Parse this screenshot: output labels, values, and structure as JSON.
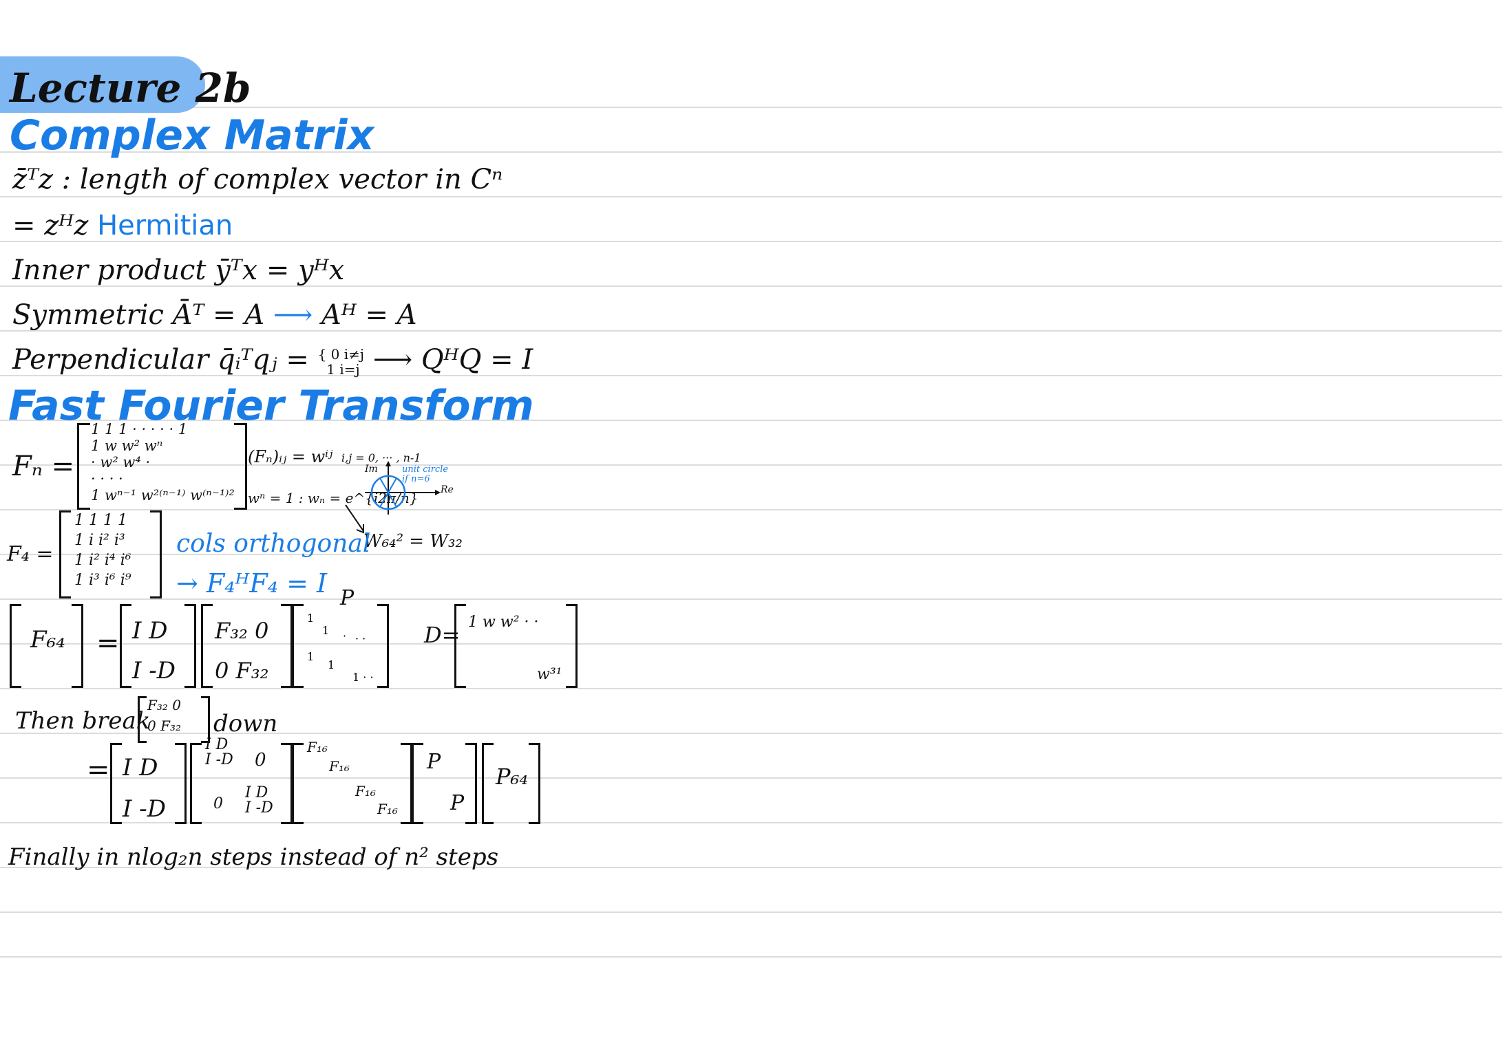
{
  "title": "Lecture 2b",
  "sections": {
    "complex_matrix": {
      "heading": "Complex Matrix",
      "line1": "z̄ᵀz : length of complex vector in Cⁿ",
      "line2_prefix": "= zᴴz",
      "line2_label": "Hermitian",
      "line3": "Inner product ȳᵀx = yᴴx",
      "line4_left": "Symmetric Āᵀ = A",
      "line4_right": "Aᴴ = A",
      "line5_left": "Perpendicular q̄ᵢᵀqⱼ =",
      "line5_case1": "0  i≠j",
      "line5_case2": "1  i=j",
      "line5_right": "QᴴQ = I"
    },
    "fft": {
      "heading": "Fast Fourier Transform",
      "fn_label": "Fₙ =",
      "fn_matrix_rows": [
        "1    1    1   · · · · ·   1",
        "1   w   w²           wⁿ",
        "·   w²  w⁴            ·",
        "·    ·    ·             ·",
        "1  wⁿ⁻¹ w²⁽ⁿ⁻¹⁾   w⁽ⁿ⁻¹⁾²"
      ],
      "fn_entry": "(Fₙ)ᵢⱼ = wⁱʲ",
      "fn_index": "i,j = 0, ··· , n-1",
      "fn_root": "wⁿ = 1 : wₙ = e^{i2π/n}",
      "circle_im": "Im",
      "circle_re": "Re",
      "circle_note1": "unit circle",
      "circle_note2": "if n=6",
      "w_relation": "W₆₄² = W₃₂",
      "f4_label": "F₄ =",
      "f4_rows": [
        "1   1   1   1",
        "1   i   i²  i³",
        "1   i²  i⁴  i⁶",
        "1   i³  i⁶  i⁹"
      ],
      "cols_note": "cols orthogonal",
      "cols_result": "→ F₄ᴴF₄ = I",
      "f64_label": "F₆₄",
      "eq": "=",
      "id_block": [
        "I   D",
        "I  -D"
      ],
      "f32_block": [
        "F₃₂    0",
        "0    F₃₂"
      ],
      "perm_label": "P",
      "d_label": "D=",
      "d_entries": [
        "1   w   w²  ·  ·",
        "w³¹"
      ],
      "then_break_prefix": "Then break",
      "then_break_block": [
        "F₃₂  0",
        "0  F₃₂"
      ],
      "then_break_suffix": "down",
      "second_eq_block1": [
        "I   D",
        "I  -D"
      ],
      "second_eq_block2_top": [
        "I D",
        "I -D"
      ],
      "second_eq_block2_zero": "0",
      "second_eq_block2_bottom": [
        "I D",
        "I -D"
      ],
      "f16_block": [
        "F₁₆",
        "F₁₆",
        "F₁₆",
        "F₁₆"
      ],
      "p_block": [
        "P",
        "P"
      ],
      "p64": "P₆₄",
      "final": "Finally in nlog₂n steps instead of n² steps"
    }
  }
}
